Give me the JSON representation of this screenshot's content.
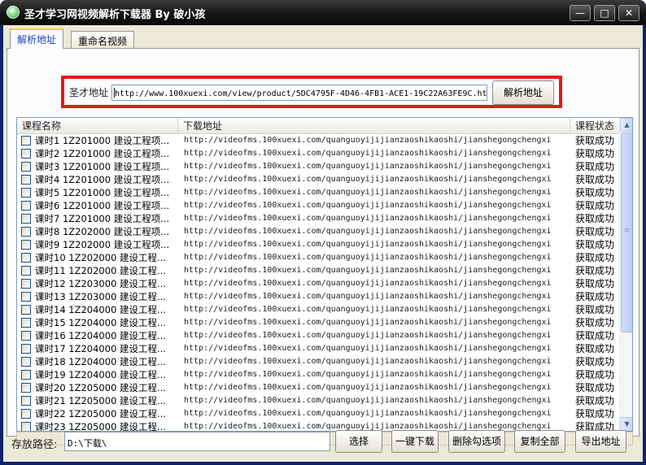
{
  "window": {
    "title": "圣才学习网视频解析下载器 By 破小孩",
    "minimize_glyph": "—",
    "maximize_glyph": "□",
    "close_glyph": "✕"
  },
  "tabs": [
    {
      "label": "解析地址",
      "active": true
    },
    {
      "label": "重命名视频",
      "active": false
    }
  ],
  "url_section": {
    "label": "圣才地址",
    "value": "http://www.100xuexi.com/view/product/5DC4795F-4D46-4FB1-ACE1-19C22A63FE9C.ht",
    "parse_button": "解析地址",
    "highlight_color": "#e81818"
  },
  "list": {
    "columns": [
      "课程名称",
      "下载地址",
      "课程状态"
    ],
    "rows": [
      {
        "name": "课时1 1Z201000  建设工程项...",
        "url": "http://videofms.100xuexi.com/quanguoyijijianzaoshikaoshi/jianshegongchengxi",
        "status": "获取成功"
      },
      {
        "name": "课时2 1Z201000  建设工程项...",
        "url": "http://videofms.100xuexi.com/quanguoyijijianzaoshikaoshi/jianshegongchengxi",
        "status": "获取成功"
      },
      {
        "name": "课时3 1Z201000  建设工程项...",
        "url": "http://videofms.100xuexi.com/quanguoyijijianzaoshikaoshi/jianshegongchengxi",
        "status": "获取成功"
      },
      {
        "name": "课时4 1Z201000  建设工程项...",
        "url": "http://videofms.100xuexi.com/quanguoyijijianzaoshikaoshi/jianshegongchengxi",
        "status": "获取成功"
      },
      {
        "name": "课时5 1Z201000  建设工程项...",
        "url": "http://videofms.100xuexi.com/quanguoyijijianzaoshikaoshi/jianshegongchengxi",
        "status": "获取成功"
      },
      {
        "name": "课时6 1Z201000  建设工程项...",
        "url": "http://videofms.100xuexi.com/quanguoyijijianzaoshikaoshi/jianshegongchengxi",
        "status": "获取成功"
      },
      {
        "name": "课时7 1Z201000  建设工程项...",
        "url": "http://videofms.100xuexi.com/quanguoyijijianzaoshikaoshi/jianshegongchengxi",
        "status": "获取成功"
      },
      {
        "name": "课时8 1Z202000  建设工程项...",
        "url": "http://videofms.100xuexi.com/quanguoyijijianzaoshikaoshi/jianshegongchengxi",
        "status": "获取成功"
      },
      {
        "name": "课时9 1Z202000  建设工程项...",
        "url": "http://videofms.100xuexi.com/quanguoyijijianzaoshikaoshi/jianshegongchengxi",
        "status": "获取成功"
      },
      {
        "name": "课时10 1Z202000  建设工程...",
        "url": "http://videofms.100xuexi.com/quanguoyijijianzaoshikaoshi/jianshegongchengxi",
        "status": "获取成功"
      },
      {
        "name": "课时11 1Z202000  建设工程...",
        "url": "http://videofms.100xuexi.com/quanguoyijijianzaoshikaoshi/jianshegongchengxi",
        "status": "获取成功"
      },
      {
        "name": "课时12 1Z203000  建设工程...",
        "url": "http://videofms.100xuexi.com/quanguoyijijianzaoshikaoshi/jianshegongchengxi",
        "status": "获取成功"
      },
      {
        "name": "课时13 1Z203000  建设工程...",
        "url": "http://videofms.100xuexi.com/quanguoyijijianzaoshikaoshi/jianshegongchengxi",
        "status": "获取成功"
      },
      {
        "name": "课时14 1Z204000  建设工程...",
        "url": "http://videofms.100xuexi.com/quanguoyijijianzaoshikaoshi/jianshegongchengxi",
        "status": "获取成功"
      },
      {
        "name": "课时15 1Z204000  建设工程...",
        "url": "http://videofms.100xuexi.com/quanguoyijijianzaoshikaoshi/jianshegongchengxi",
        "status": "获取成功"
      },
      {
        "name": "课时16 1Z204000  建设工程...",
        "url": "http://videofms.100xuexi.com/quanguoyijijianzaoshikaoshi/jianshegongchengxi",
        "status": "获取成功"
      },
      {
        "name": "课时17 1Z204000  建设工程...",
        "url": "http://videofms.100xuexi.com/quanguoyijijianzaoshikaoshi/jianshegongchengxi",
        "status": "获取成功"
      },
      {
        "name": "课时18 1Z204000  建设工程...",
        "url": "http://videofms.100xuexi.com/quanguoyijijianzaoshikaoshi/jianshegongchengxi",
        "status": "获取成功"
      },
      {
        "name": "课时19 1Z204000  建设工程...",
        "url": "http://videofms.100xuexi.com/quanguoyijijianzaoshikaoshi/jianshegongchengxi",
        "status": "获取成功"
      },
      {
        "name": "课时20 1Z205000  建设工程...",
        "url": "http://videofms.100xuexi.com/quanguoyijijianzaoshikaoshi/jianshegongchengxi",
        "status": "获取成功"
      },
      {
        "name": "课时21 1Z205000  建设工程...",
        "url": "http://videofms.100xuexi.com/quanguoyijijianzaoshikaoshi/jianshegongchengxi",
        "status": "获取成功"
      },
      {
        "name": "课时22 1Z205000  建设工程...",
        "url": "http://videofms.100xuexi.com/quanguoyijijianzaoshikaoshi/jianshegongchengxi",
        "status": "获取成功"
      },
      {
        "name": "课时23 1Z205000  建设工程...",
        "url": "http://videofms.100xuexi.com/quanguoyijijianzaoshikaoshi/jianshegongchengxi",
        "status": "获取成功"
      }
    ]
  },
  "bottom": {
    "path_label": "存放路径:",
    "path_value": "D:\\下载\\",
    "buttons": [
      "选择",
      "一键下载",
      "删除勾选项",
      "复制全部",
      "导出地址"
    ]
  }
}
